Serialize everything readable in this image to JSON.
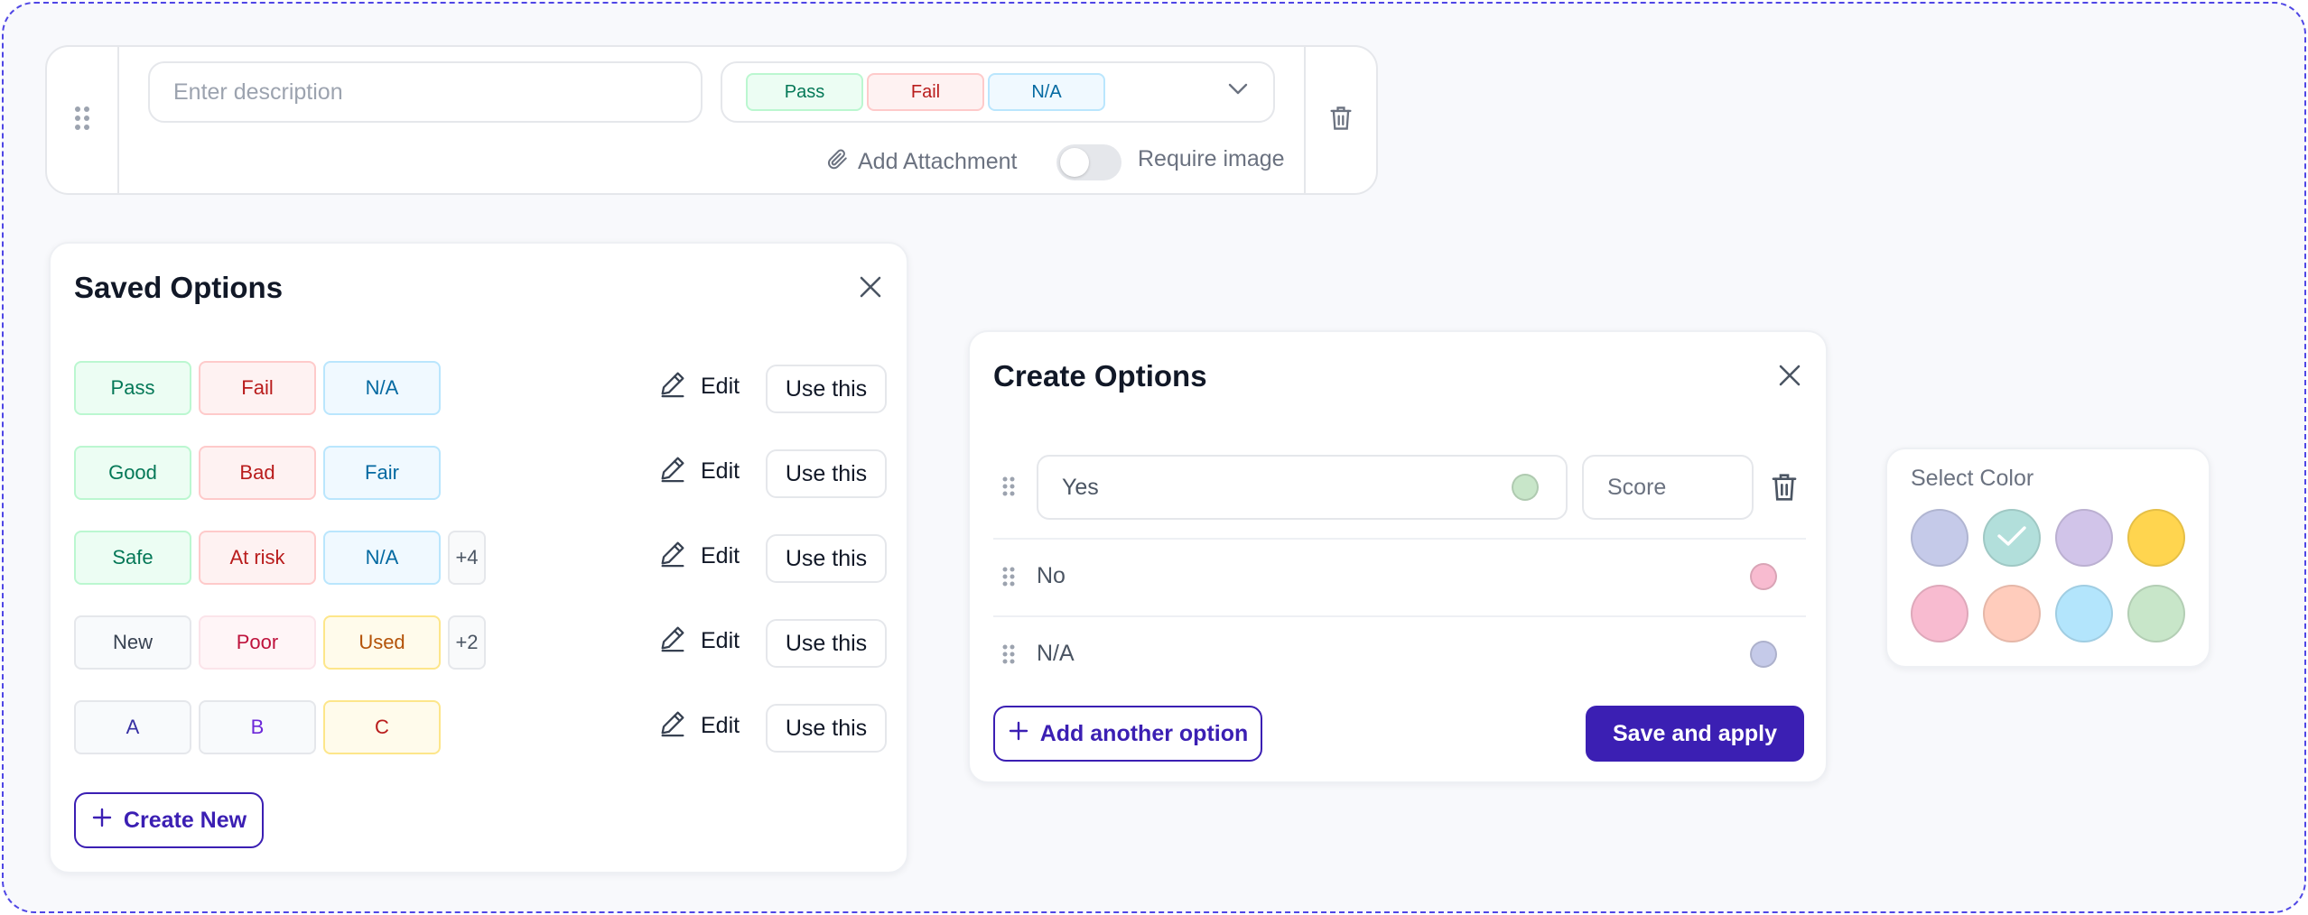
{
  "question": {
    "description_placeholder": "Enter description",
    "response_chips": [
      {
        "label": "Pass",
        "text": "#047857",
        "bg": "#ecfdf3",
        "border": "#bbf7d0"
      },
      {
        "label": "Fail",
        "text": "#b91c1c",
        "bg": "#fef2f2",
        "border": "#fecaca"
      },
      {
        "label": "N/A",
        "text": "#0369a1",
        "bg": "#f0f9ff",
        "border": "#bae6fd"
      }
    ],
    "attachment_label": "Add Attachment",
    "require_image_label": "Require image",
    "require_image_on": false
  },
  "saved_options": {
    "title": "Saved Options",
    "edit_label": "Edit",
    "use_label": "Use this",
    "create_new_label": "Create New",
    "rows": [
      {
        "chips": [
          {
            "label": "Pass",
            "text": "#047857",
            "bg": "#ecfdf3",
            "border": "#bbf7d0"
          },
          {
            "label": "Fail",
            "text": "#b91c1c",
            "bg": "#fef2f2",
            "border": "#fecaca"
          },
          {
            "label": "N/A",
            "text": "#0369a1",
            "bg": "#f0f9ff",
            "border": "#bae6fd"
          }
        ],
        "more": ""
      },
      {
        "chips": [
          {
            "label": "Good",
            "text": "#047857",
            "bg": "#ecfdf3",
            "border": "#bbf7d0"
          },
          {
            "label": "Bad",
            "text": "#b91c1c",
            "bg": "#fef2f2",
            "border": "#fecaca"
          },
          {
            "label": "Fair",
            "text": "#0369a1",
            "bg": "#f0f9ff",
            "border": "#bae6fd"
          }
        ],
        "more": ""
      },
      {
        "chips": [
          {
            "label": "Safe",
            "text": "#047857",
            "bg": "#ecfdf3",
            "border": "#bbf7d0"
          },
          {
            "label": "At risk",
            "text": "#b91c1c",
            "bg": "#fef2f2",
            "border": "#fecaca"
          },
          {
            "label": "N/A",
            "text": "#0369a1",
            "bg": "#f0f9ff",
            "border": "#bae6fd"
          }
        ],
        "more": "+4"
      },
      {
        "chips": [
          {
            "label": "New",
            "text": "#374151",
            "bg": "#f8fafc",
            "border": "#e5e7eb"
          },
          {
            "label": "Poor",
            "text": "#be123c",
            "bg": "#fff5f7",
            "border": "#fbe4ea"
          },
          {
            "label": "Used",
            "text": "#b45309",
            "bg": "#fffbeb",
            "border": "#fde68a"
          }
        ],
        "more": "+2"
      },
      {
        "chips": [
          {
            "label": "A",
            "text": "#3730a3",
            "bg": "#f8fafc",
            "border": "#e5e7eb"
          },
          {
            "label": "B",
            "text": "#6d28d9",
            "bg": "#f8fafc",
            "border": "#e5e7eb"
          },
          {
            "label": "C",
            "text": "#b91c1c",
            "bg": "#fffbeb",
            "border": "#fde68a"
          }
        ],
        "more": ""
      }
    ]
  },
  "create_options": {
    "title": "Create Options",
    "first_option_value": "Yes",
    "first_option_color": "#c8e6c9",
    "score_placeholder": "Score",
    "other_options": [
      {
        "label": "No",
        "color": "#f8bbd0"
      },
      {
        "label": "N/A",
        "color": "#c5cae9"
      }
    ],
    "add_another_label": "Add another option",
    "save_label": "Save and apply"
  },
  "color_picker": {
    "title": "Select Color",
    "selected_index": 1,
    "swatches": [
      "#c5cae9",
      "#b2dfdb",
      "#d1c4e9",
      "#ffd54f",
      "#f8bbd0",
      "#ffccbc",
      "#b3e5fc",
      "#c8e6c9"
    ]
  }
}
